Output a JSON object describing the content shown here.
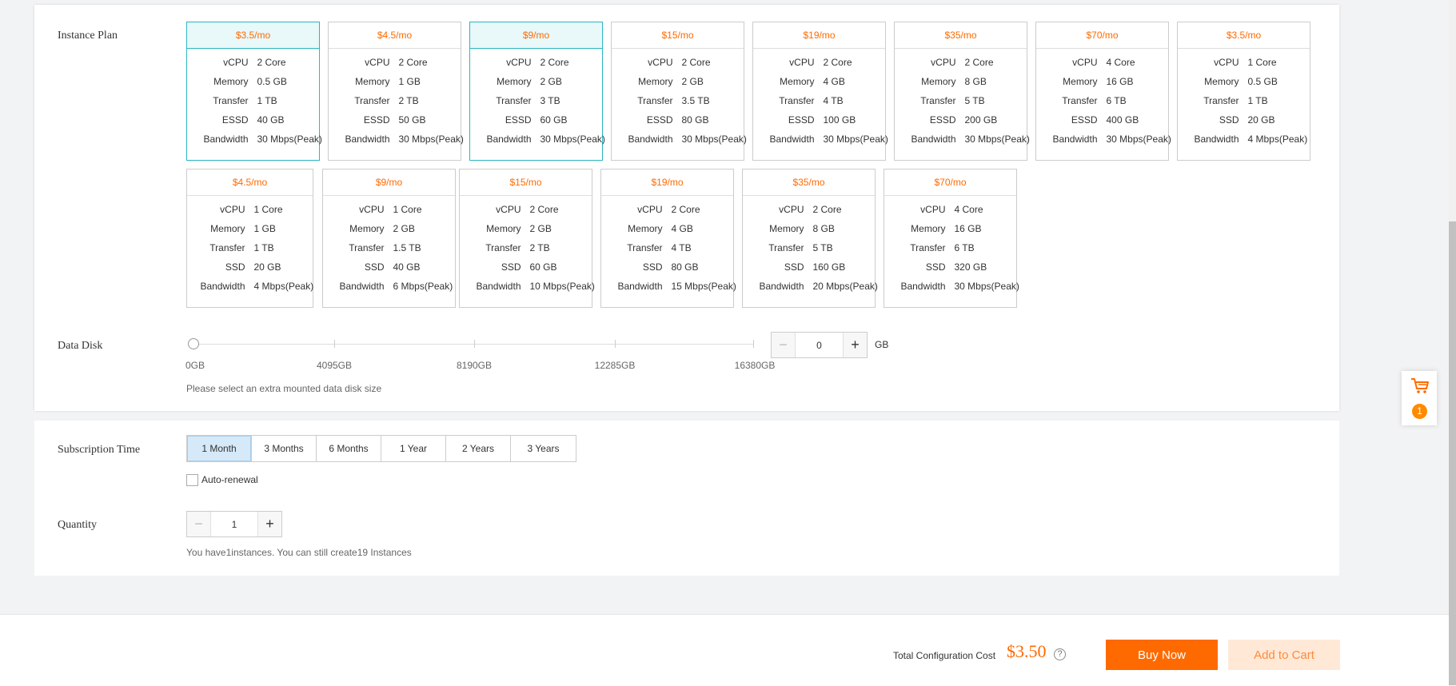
{
  "instance_plan": {
    "label": "Instance Plan",
    "plans": [
      {
        "price": "$3.5/mo",
        "selected": true,
        "specs": [
          [
            "vCPU",
            "2 Core"
          ],
          [
            "Memory",
            "0.5 GB"
          ],
          [
            "Transfer",
            "1 TB"
          ],
          [
            "ESSD",
            "40 GB"
          ],
          [
            "Bandwidth",
            "30 Mbps(Peak)"
          ]
        ]
      },
      {
        "price": "$4.5/mo",
        "selected": false,
        "specs": [
          [
            "vCPU",
            "2 Core"
          ],
          [
            "Memory",
            "1 GB"
          ],
          [
            "Transfer",
            "2 TB"
          ],
          [
            "ESSD",
            "50 GB"
          ],
          [
            "Bandwidth",
            "30 Mbps(Peak)"
          ]
        ]
      },
      {
        "price": "$9/mo",
        "selected": true,
        "specs": [
          [
            "vCPU",
            "2 Core"
          ],
          [
            "Memory",
            "2 GB"
          ],
          [
            "Transfer",
            "3 TB"
          ],
          [
            "ESSD",
            "60 GB"
          ],
          [
            "Bandwidth",
            "30 Mbps(Peak)"
          ]
        ]
      },
      {
        "price": "$15/mo",
        "selected": false,
        "specs": [
          [
            "vCPU",
            "2 Core"
          ],
          [
            "Memory",
            "2 GB"
          ],
          [
            "Transfer",
            "3.5 TB"
          ],
          [
            "ESSD",
            "80 GB"
          ],
          [
            "Bandwidth",
            "30 Mbps(Peak)"
          ]
        ]
      },
      {
        "price": "$19/mo",
        "selected": false,
        "specs": [
          [
            "vCPU",
            "2 Core"
          ],
          [
            "Memory",
            "4 GB"
          ],
          [
            "Transfer",
            "4 TB"
          ],
          [
            "ESSD",
            "100 GB"
          ],
          [
            "Bandwidth",
            "30 Mbps(Peak)"
          ]
        ]
      },
      {
        "price": "$35/mo",
        "selected": false,
        "specs": [
          [
            "vCPU",
            "2 Core"
          ],
          [
            "Memory",
            "8 GB"
          ],
          [
            "Transfer",
            "5 TB"
          ],
          [
            "ESSD",
            "200 GB"
          ],
          [
            "Bandwidth",
            "30 Mbps(Peak)"
          ]
        ]
      },
      {
        "price": "$70/mo",
        "selected": false,
        "specs": [
          [
            "vCPU",
            "4 Core"
          ],
          [
            "Memory",
            "16 GB"
          ],
          [
            "Transfer",
            "6 TB"
          ],
          [
            "ESSD",
            "400 GB"
          ],
          [
            "Bandwidth",
            "30 Mbps(Peak)"
          ]
        ]
      },
      {
        "price": "$3.5/mo",
        "selected": false,
        "specs": [
          [
            "vCPU",
            "1 Core"
          ],
          [
            "Memory",
            "0.5 GB"
          ],
          [
            "Transfer",
            "1 TB"
          ],
          [
            "SSD",
            "20 GB"
          ],
          [
            "Bandwidth",
            "4 Mbps(Peak)"
          ]
        ]
      },
      {
        "price": "$4.5/mo",
        "selected": false,
        "specs": [
          [
            "vCPU",
            "1 Core"
          ],
          [
            "Memory",
            "1 GB"
          ],
          [
            "Transfer",
            "1 TB"
          ],
          [
            "SSD",
            "20 GB"
          ],
          [
            "Bandwidth",
            "4 Mbps(Peak)"
          ]
        ]
      },
      {
        "price": "$9/mo",
        "selected": false,
        "specs": [
          [
            "vCPU",
            "1 Core"
          ],
          [
            "Memory",
            "2 GB"
          ],
          [
            "Transfer",
            "1.5 TB"
          ],
          [
            "SSD",
            "40 GB"
          ],
          [
            "Bandwidth",
            "6 Mbps(Peak)"
          ]
        ]
      },
      {
        "price": "$15/mo",
        "selected": false,
        "specs": [
          [
            "vCPU",
            "2 Core"
          ],
          [
            "Memory",
            "2 GB"
          ],
          [
            "Transfer",
            "2 TB"
          ],
          [
            "SSD",
            "60 GB"
          ],
          [
            "Bandwidth",
            "10 Mbps(Peak)"
          ]
        ]
      },
      {
        "price": "$19/mo",
        "selected": false,
        "specs": [
          [
            "vCPU",
            "2 Core"
          ],
          [
            "Memory",
            "4 GB"
          ],
          [
            "Transfer",
            "4 TB"
          ],
          [
            "SSD",
            "80 GB"
          ],
          [
            "Bandwidth",
            "15 Mbps(Peak)"
          ]
        ]
      },
      {
        "price": "$35/mo",
        "selected": false,
        "specs": [
          [
            "vCPU",
            "2 Core"
          ],
          [
            "Memory",
            "8 GB"
          ],
          [
            "Transfer",
            "5 TB"
          ],
          [
            "SSD",
            "160 GB"
          ],
          [
            "Bandwidth",
            "20 Mbps(Peak)"
          ]
        ]
      },
      {
        "price": "$70/mo",
        "selected": false,
        "specs": [
          [
            "vCPU",
            "4 Core"
          ],
          [
            "Memory",
            "16 GB"
          ],
          [
            "Transfer",
            "6 TB"
          ],
          [
            "SSD",
            "320 GB"
          ],
          [
            "Bandwidth",
            "30 Mbps(Peak)"
          ]
        ]
      }
    ]
  },
  "data_disk": {
    "label": "Data Disk",
    "ticks": [
      "0GB",
      "4095GB",
      "8190GB",
      "12285GB",
      "16380GB"
    ],
    "value": "0",
    "unit": "GB",
    "hint": "Please select an extra mounted data disk size",
    "minus_icon": "minus-icon",
    "plus_icon": "plus-icon"
  },
  "subscription": {
    "label": "Subscription Time",
    "options": [
      "1 Month",
      "3 Months",
      "6 Months",
      "1 Year",
      "2 Years",
      "3 Years"
    ],
    "selected_index": 0,
    "auto_renewal_label": "Auto-renewal",
    "auto_renewal_checked": false
  },
  "quantity": {
    "label": "Quantity",
    "value": "1",
    "hint": "You have1instances. You can still create19 Instances"
  },
  "footer": {
    "cost_label": "Total Configuration Cost",
    "cost_value": "$3.50",
    "help_icon": "question-circle-icon",
    "buy_label": "Buy Now",
    "cart_label": "Add to Cart"
  },
  "floating_cart": {
    "icon": "shopping-cart-icon",
    "badge": "1"
  },
  "colors": {
    "accent": "#ff6a00",
    "selected_border": "#29b6c1",
    "selected_bg": "#e9f8f9",
    "segment_active": "#d5e9f8"
  }
}
